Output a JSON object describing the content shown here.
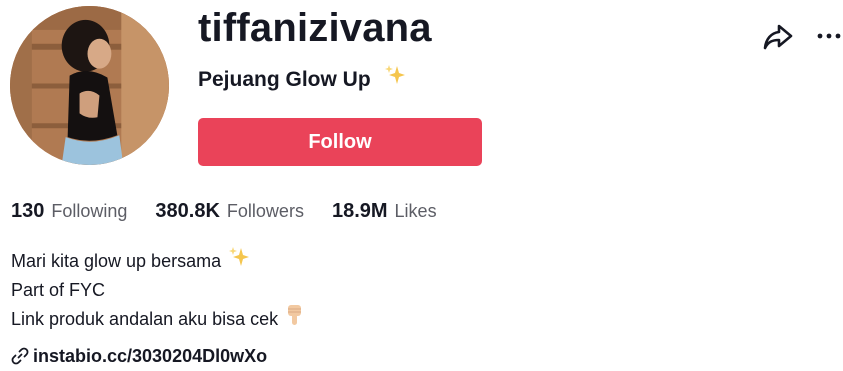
{
  "profile": {
    "username": "tiffanizivana",
    "nickname": "Pejuang Glow Up",
    "nickname_emoji": "sparkles-icon"
  },
  "actions": {
    "follow_label": "Follow",
    "follow_color": "#ea4359",
    "share_icon": "share-arrow-icon",
    "more_icon": "more-dots-icon"
  },
  "stats": [
    {
      "value": "130",
      "label": "Following"
    },
    {
      "value": "380.8K",
      "label": "Followers"
    },
    {
      "value": "18.9M",
      "label": "Likes"
    }
  ],
  "bio": {
    "lines": [
      {
        "text": "Mari kita glow up bersama",
        "emoji": "sparkles-icon"
      },
      {
        "text": "Part of FYC"
      },
      {
        "text": "Link produk andalan aku bisa cek",
        "emoji": "pointing-down-icon"
      }
    ]
  },
  "link": {
    "icon": "link-icon",
    "text": "instabio.cc/3030204Dl0wXo"
  },
  "colors": {
    "primary_text": "#161823",
    "secondary_text": "#5c5d65",
    "accent": "#ea4359",
    "sparkle": "#f5c64e"
  }
}
